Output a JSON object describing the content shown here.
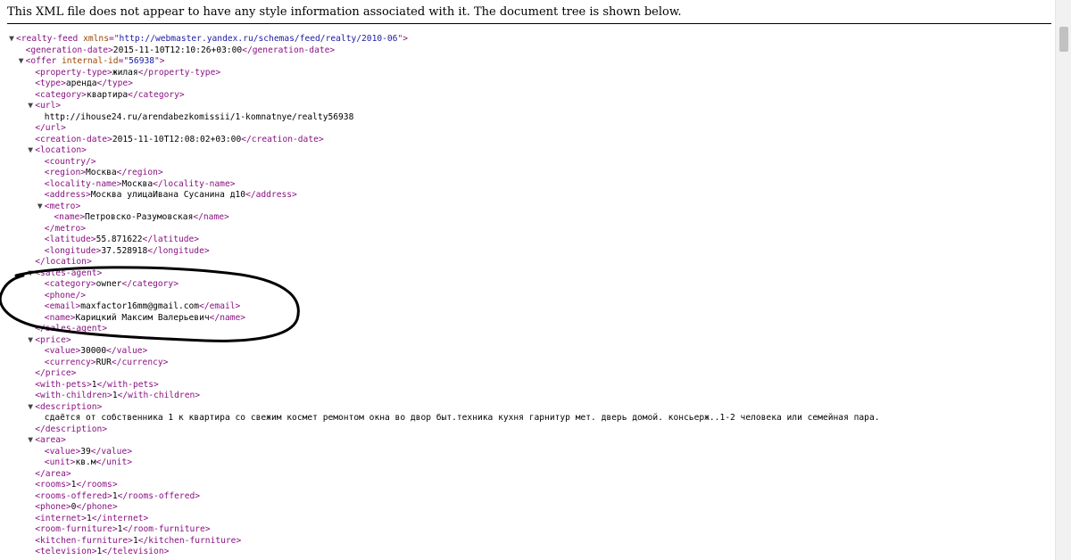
{
  "notice": "This XML file does not appear to have any style information associated with it. The document tree is shown below.",
  "lines": [
    {
      "indent": 0,
      "toggle": "▼",
      "segs": [
        [
          "tag",
          "<realty-feed "
        ],
        [
          "attr-name",
          "xmlns"
        ],
        [
          "tag",
          "=\""
        ],
        [
          "attr-value",
          "http://webmaster.yandex.ru/schemas/feed/realty/2010-06"
        ],
        [
          "tag",
          "\">"
        ]
      ]
    },
    {
      "indent": 1,
      "segs": [
        [
          "tag",
          "<generation-date>"
        ],
        [
          "text",
          "2015-11-10T12:10:26+03:00"
        ],
        [
          "tag",
          "</generation-date>"
        ]
      ]
    },
    {
      "indent": 1,
      "toggle": "▼",
      "segs": [
        [
          "tag",
          "<offer "
        ],
        [
          "attr-name",
          "internal-id"
        ],
        [
          "tag",
          "=\""
        ],
        [
          "attr-value",
          "56938"
        ],
        [
          "tag",
          "\">"
        ]
      ]
    },
    {
      "indent": 2,
      "segs": [
        [
          "tag",
          "<property-type>"
        ],
        [
          "text",
          "жилая"
        ],
        [
          "tag",
          "</property-type>"
        ]
      ]
    },
    {
      "indent": 2,
      "segs": [
        [
          "tag",
          "<type>"
        ],
        [
          "text",
          "аренда"
        ],
        [
          "tag",
          "</type>"
        ]
      ]
    },
    {
      "indent": 2,
      "segs": [
        [
          "tag",
          "<category>"
        ],
        [
          "text",
          "квартира"
        ],
        [
          "tag",
          "</category>"
        ]
      ]
    },
    {
      "indent": 2,
      "toggle": "▼",
      "segs": [
        [
          "tag",
          "<url>"
        ]
      ]
    },
    {
      "indent": 3,
      "segs": [
        [
          "text",
          "http://ihouse24.ru/arendabezkomissii/1-komnatnye/realty56938"
        ]
      ]
    },
    {
      "indent": 2,
      "segs": [
        [
          "tag",
          "</url>"
        ]
      ]
    },
    {
      "indent": 2,
      "segs": [
        [
          "tag",
          "<creation-date>"
        ],
        [
          "text",
          "2015-11-10T12:08:02+03:00"
        ],
        [
          "tag",
          "</creation-date>"
        ]
      ]
    },
    {
      "indent": 2,
      "toggle": "▼",
      "segs": [
        [
          "tag",
          "<location>"
        ]
      ]
    },
    {
      "indent": 3,
      "segs": [
        [
          "tag",
          "<country/>"
        ]
      ]
    },
    {
      "indent": 3,
      "segs": [
        [
          "tag",
          "<region>"
        ],
        [
          "text",
          "Москва"
        ],
        [
          "tag",
          "</region>"
        ]
      ]
    },
    {
      "indent": 3,
      "segs": [
        [
          "tag",
          "<locality-name>"
        ],
        [
          "text",
          "Москва"
        ],
        [
          "tag",
          "</locality-name>"
        ]
      ]
    },
    {
      "indent": 3,
      "segs": [
        [
          "tag",
          "<address>"
        ],
        [
          "text",
          "Москва улицаИвана Сусанина д10"
        ],
        [
          "tag",
          "</address>"
        ]
      ]
    },
    {
      "indent": 3,
      "toggle": "▼",
      "segs": [
        [
          "tag",
          "<metro>"
        ]
      ]
    },
    {
      "indent": 4,
      "segs": [
        [
          "tag",
          "<name>"
        ],
        [
          "text",
          "Петровско-Разумовская"
        ],
        [
          "tag",
          "</name>"
        ]
      ]
    },
    {
      "indent": 3,
      "segs": [
        [
          "tag",
          "</metro>"
        ]
      ]
    },
    {
      "indent": 3,
      "segs": [
        [
          "tag",
          "<latitude>"
        ],
        [
          "text",
          "55.871622"
        ],
        [
          "tag",
          "</latitude>"
        ]
      ]
    },
    {
      "indent": 3,
      "segs": [
        [
          "tag",
          "<longitude>"
        ],
        [
          "text",
          "37.528918"
        ],
        [
          "tag",
          "</longitude>"
        ]
      ]
    },
    {
      "indent": 2,
      "segs": [
        [
          "tag",
          "</location>"
        ]
      ]
    },
    {
      "indent": 2,
      "toggle": "▼",
      "segs": [
        [
          "tag",
          "<sales-agent>"
        ]
      ]
    },
    {
      "indent": 3,
      "segs": [
        [
          "tag",
          "<category>"
        ],
        [
          "text",
          "owner"
        ],
        [
          "tag",
          "</category>"
        ]
      ]
    },
    {
      "indent": 3,
      "segs": [
        [
          "tag",
          "<phone/>"
        ]
      ]
    },
    {
      "indent": 3,
      "segs": [
        [
          "tag",
          "<email>"
        ],
        [
          "text",
          "maxfactor16mm@gmail.com"
        ],
        [
          "tag",
          "</email>"
        ]
      ]
    },
    {
      "indent": 3,
      "segs": [
        [
          "tag",
          "<name>"
        ],
        [
          "text",
          "Карицкий Максим Валерьевич"
        ],
        [
          "tag",
          "</name>"
        ]
      ]
    },
    {
      "indent": 2,
      "segs": [
        [
          "tag",
          "</sales-agent>"
        ]
      ]
    },
    {
      "indent": 2,
      "toggle": "▼",
      "segs": [
        [
          "tag",
          "<price>"
        ]
      ]
    },
    {
      "indent": 3,
      "segs": [
        [
          "tag",
          "<value>"
        ],
        [
          "text",
          "30000"
        ],
        [
          "tag",
          "</value>"
        ]
      ]
    },
    {
      "indent": 3,
      "segs": [
        [
          "tag",
          "<currency>"
        ],
        [
          "text",
          "RUR"
        ],
        [
          "tag",
          "</currency>"
        ]
      ]
    },
    {
      "indent": 2,
      "segs": [
        [
          "tag",
          "</price>"
        ]
      ]
    },
    {
      "indent": 2,
      "segs": [
        [
          "tag",
          "<with-pets>"
        ],
        [
          "text",
          "1"
        ],
        [
          "tag",
          "</with-pets>"
        ]
      ]
    },
    {
      "indent": 2,
      "segs": [
        [
          "tag",
          "<with-children>"
        ],
        [
          "text",
          "1"
        ],
        [
          "tag",
          "</with-children>"
        ]
      ]
    },
    {
      "indent": 2,
      "toggle": "▼",
      "segs": [
        [
          "tag",
          "<description>"
        ]
      ]
    },
    {
      "indent": 3,
      "segs": [
        [
          "text",
          "сдаётся от собственника 1 к квартира со свежим космет ремонтом окна во двор быт.техника кухня гарнитур мет. дверь домой. консьерж..1-2 человека или семейная пара."
        ]
      ]
    },
    {
      "indent": 2,
      "segs": [
        [
          "tag",
          "</description>"
        ]
      ]
    },
    {
      "indent": 2,
      "toggle": "▼",
      "segs": [
        [
          "tag",
          "<area>"
        ]
      ]
    },
    {
      "indent": 3,
      "segs": [
        [
          "tag",
          "<value>"
        ],
        [
          "text",
          "39"
        ],
        [
          "tag",
          "</value>"
        ]
      ]
    },
    {
      "indent": 3,
      "segs": [
        [
          "tag",
          "<unit>"
        ],
        [
          "text",
          "кв.м"
        ],
        [
          "tag",
          "</unit>"
        ]
      ]
    },
    {
      "indent": 2,
      "segs": [
        [
          "tag",
          "</area>"
        ]
      ]
    },
    {
      "indent": 2,
      "segs": [
        [
          "tag",
          "<rooms>"
        ],
        [
          "text",
          "1"
        ],
        [
          "tag",
          "</rooms>"
        ]
      ]
    },
    {
      "indent": 2,
      "segs": [
        [
          "tag",
          "<rooms-offered>"
        ],
        [
          "text",
          "1"
        ],
        [
          "tag",
          "</rooms-offered>"
        ]
      ]
    },
    {
      "indent": 2,
      "segs": [
        [
          "tag",
          "<phone>"
        ],
        [
          "text",
          "0"
        ],
        [
          "tag",
          "</phone>"
        ]
      ]
    },
    {
      "indent": 2,
      "segs": [
        [
          "tag",
          "<internet>"
        ],
        [
          "text",
          "1"
        ],
        [
          "tag",
          "</internet>"
        ]
      ]
    },
    {
      "indent": 2,
      "segs": [
        [
          "tag",
          "<room-furniture>"
        ],
        [
          "text",
          "1"
        ],
        [
          "tag",
          "</room-furniture>"
        ]
      ]
    },
    {
      "indent": 2,
      "segs": [
        [
          "tag",
          "<kitchen-furniture>"
        ],
        [
          "text",
          "1"
        ],
        [
          "tag",
          "</kitchen-furniture>"
        ]
      ]
    },
    {
      "indent": 2,
      "segs": [
        [
          "tag",
          "<television>"
        ],
        [
          "text",
          "1"
        ],
        [
          "tag",
          "</television>"
        ]
      ]
    }
  ]
}
